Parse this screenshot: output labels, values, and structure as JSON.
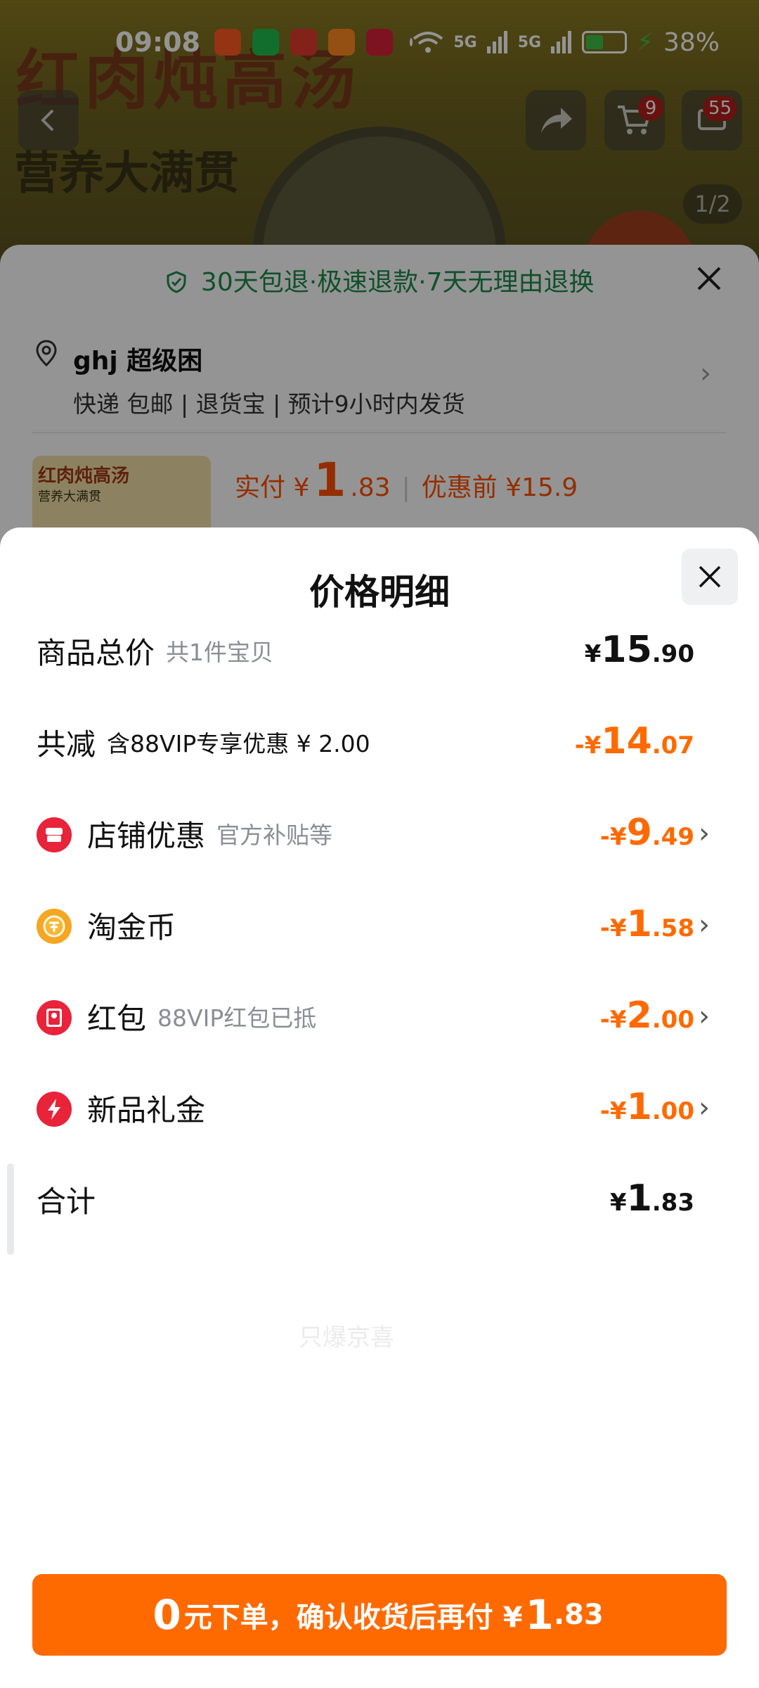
{
  "status_bar": {
    "time": "09:08",
    "sig1": "5G",
    "sig2": "5G",
    "battery": "38%"
  },
  "hero": {
    "title": "红肉炖高汤",
    "subtitle": "营养大满贯",
    "cart_badge": "9",
    "msg_badge": "55",
    "page_indicator": "1/2"
  },
  "order_sheet": {
    "guarantee": "30天包退·极速退款·7天无理由退换",
    "address_name": "ghj 超级困",
    "address_info": "快递 包邮 | 退货宝 | 预计9小时内发货",
    "thumb_title": "红肉炖高汤",
    "thumb_subtitle": "营养大满贯",
    "price_label": "实付 ¥",
    "price_int": "1",
    "price_dec": ".83",
    "price_before": "优惠前 ¥15.9"
  },
  "price_detail": {
    "title": "价格明细",
    "total": {
      "label": "商品总价",
      "sub": "共1件宝贝",
      "sym": "¥",
      "int": "15",
      "dec": ".90"
    },
    "reduce": {
      "label": "共减",
      "sub": "含88VIP专享优惠 ¥ 2.00",
      "sym": "-¥",
      "int": "14",
      "dec": ".07"
    },
    "shop": {
      "label": "店铺优惠",
      "sub": "官方补贴等",
      "sym": "-¥",
      "int": "9",
      "dec": ".49"
    },
    "coins": {
      "label": "淘金币",
      "sub": "",
      "sym": "-¥",
      "int": "1",
      "dec": ".58"
    },
    "redpacket": {
      "label": "红包",
      "sub": "88VIP红包已抵",
      "sym": "-¥",
      "int": "2",
      "dec": ".00"
    },
    "newgift": {
      "label": "新品礼金",
      "sub": "",
      "sym": "-¥",
      "int": "1",
      "dec": ".00"
    },
    "sum": {
      "label": "合计",
      "sym": "¥",
      "int": "1",
      "dec": ".83"
    },
    "watermark": "只爆京喜"
  },
  "order_button": {
    "int": "0",
    "text": "元下单，确认收货后再付 ¥",
    "amount_int": "1",
    "amount_dec": ".83"
  },
  "colors": {
    "accent": "#ff6a00",
    "green": "#1c8a4a",
    "red_icon": "#e8233a",
    "gold_icon": "#f5a623"
  }
}
